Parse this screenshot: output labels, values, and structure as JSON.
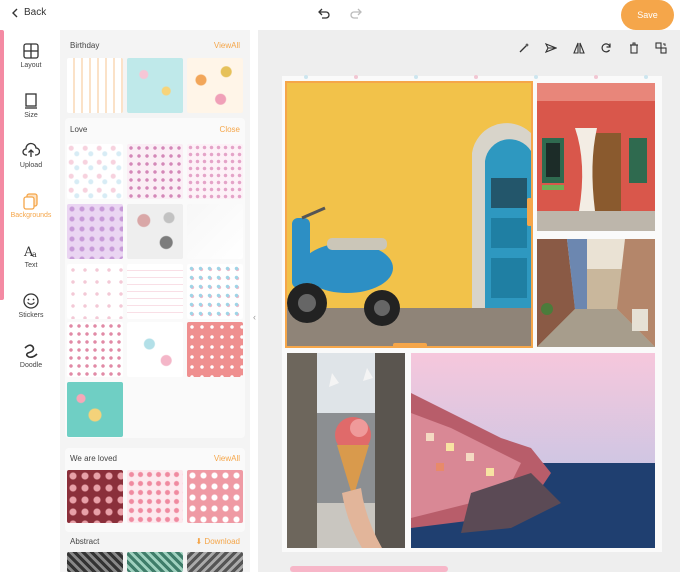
{
  "topbar": {
    "back_label": "Back",
    "save_label": "Save"
  },
  "rail": {
    "items": [
      {
        "label": "Layout",
        "icon": "layout-icon"
      },
      {
        "label": "Size",
        "icon": "size-icon"
      },
      {
        "label": "Upload",
        "icon": "upload-icon"
      },
      {
        "label": "Backgrounds",
        "icon": "backgrounds-icon"
      },
      {
        "label": "Text",
        "icon": "text-icon"
      },
      {
        "label": "Stickers",
        "icon": "stickers-icon"
      },
      {
        "label": "Doodle",
        "icon": "doodle-icon"
      }
    ],
    "active": "Backgrounds"
  },
  "panel": {
    "sections": [
      {
        "title": "Birthday",
        "action": "ViewAll"
      },
      {
        "title": "Love",
        "action": "Close"
      },
      {
        "title": "We are loved",
        "action": "ViewAll"
      },
      {
        "title": "Abstract",
        "action": "Download"
      }
    ]
  },
  "colors": {
    "accent": "#f5a64a",
    "pink": "#f48aa3"
  }
}
